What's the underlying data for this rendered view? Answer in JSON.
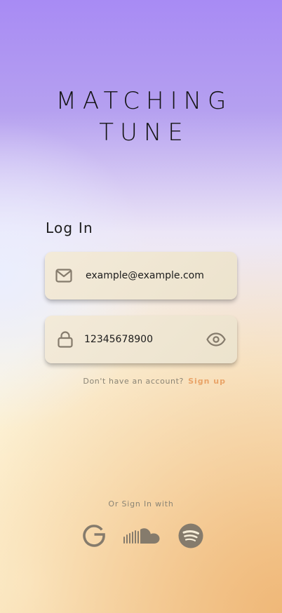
{
  "app": {
    "title_line1": "MATCHING",
    "title_line2": "TUNE"
  },
  "login": {
    "heading": "Log In",
    "email_value": "example@example.com",
    "password_value": "12345678900",
    "signup_prompt": "Don't have an account?",
    "signup_link": "Sign up"
  },
  "social": {
    "label": "Or Sign In with",
    "providers": [
      "google-icon",
      "soundcloud-icon",
      "spotify-icon"
    ]
  },
  "colors": {
    "accent": "#e9a368",
    "icon": "#857b6c",
    "text": "#1b1b1b"
  }
}
